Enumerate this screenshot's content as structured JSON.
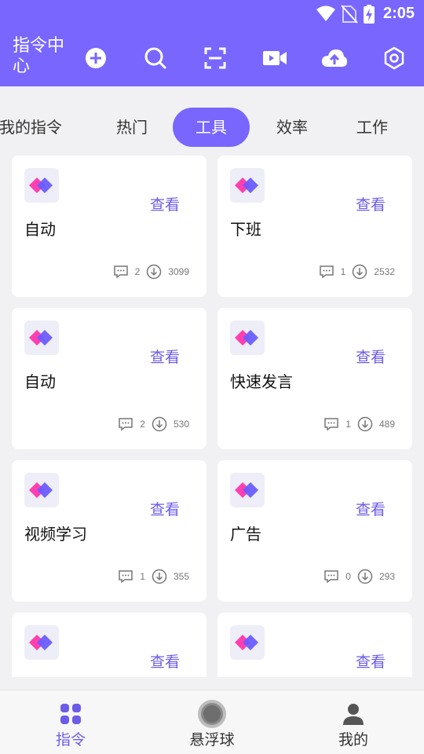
{
  "status_bar": {
    "time": "2:05"
  },
  "header": {
    "title": "指令中心"
  },
  "toolbar_icons": [
    "add-circle-icon",
    "search-icon",
    "scan-icon",
    "video-icon",
    "cloud-upload-icon",
    "settings-hexagon-icon"
  ],
  "tabs": [
    {
      "label": "我的指令",
      "active": false
    },
    {
      "label": "热门",
      "active": false
    },
    {
      "label": "工具",
      "active": true
    },
    {
      "label": "效率",
      "active": false
    },
    {
      "label": "工作",
      "active": false
    }
  ],
  "view_label": "查看",
  "cards": [
    {
      "title": "自动",
      "comments": "2",
      "downloads": "3099"
    },
    {
      "title": "下班",
      "comments": "1",
      "downloads": "2532"
    },
    {
      "title": "自动",
      "comments": "2",
      "downloads": "530"
    },
    {
      "title": "快速发言",
      "comments": "1",
      "downloads": "489"
    },
    {
      "title": "视频学习",
      "comments": "1",
      "downloads": "355"
    },
    {
      "title": "广告",
      "comments": "0",
      "downloads": "293"
    },
    {
      "title": "",
      "comments": "",
      "downloads": ""
    },
    {
      "title": "",
      "comments": "",
      "downloads": ""
    }
  ],
  "bottom_nav": [
    {
      "label": "指令",
      "active": true
    },
    {
      "label": "悬浮球",
      "active": false
    },
    {
      "label": "我的",
      "active": false
    }
  ],
  "colors": {
    "accent": "#7866ff",
    "accent_text": "#6c5ce7",
    "background": "#f1f1f3"
  }
}
